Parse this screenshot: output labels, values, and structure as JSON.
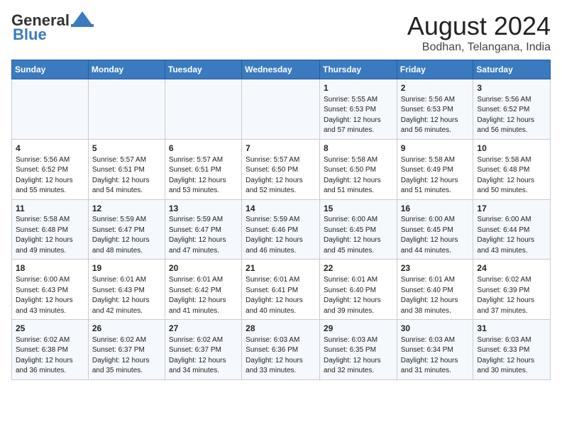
{
  "logo": {
    "line1": "General",
    "line2": "Blue"
  },
  "title": "August 2024",
  "subtitle": "Bodhan, Telangana, India",
  "weekdays": [
    "Sunday",
    "Monday",
    "Tuesday",
    "Wednesday",
    "Thursday",
    "Friday",
    "Saturday"
  ],
  "weeks": [
    [
      {
        "day": "",
        "info": ""
      },
      {
        "day": "",
        "info": ""
      },
      {
        "day": "",
        "info": ""
      },
      {
        "day": "",
        "info": ""
      },
      {
        "day": "1",
        "info": "Sunrise: 5:55 AM\nSunset: 6:53 PM\nDaylight: 12 hours\nand 57 minutes."
      },
      {
        "day": "2",
        "info": "Sunrise: 5:56 AM\nSunset: 6:53 PM\nDaylight: 12 hours\nand 56 minutes."
      },
      {
        "day": "3",
        "info": "Sunrise: 5:56 AM\nSunset: 6:52 PM\nDaylight: 12 hours\nand 56 minutes."
      }
    ],
    [
      {
        "day": "4",
        "info": "Sunrise: 5:56 AM\nSunset: 6:52 PM\nDaylight: 12 hours\nand 55 minutes."
      },
      {
        "day": "5",
        "info": "Sunrise: 5:57 AM\nSunset: 6:51 PM\nDaylight: 12 hours\nand 54 minutes."
      },
      {
        "day": "6",
        "info": "Sunrise: 5:57 AM\nSunset: 6:51 PM\nDaylight: 12 hours\nand 53 minutes."
      },
      {
        "day": "7",
        "info": "Sunrise: 5:57 AM\nSunset: 6:50 PM\nDaylight: 12 hours\nand 52 minutes."
      },
      {
        "day": "8",
        "info": "Sunrise: 5:58 AM\nSunset: 6:50 PM\nDaylight: 12 hours\nand 51 minutes."
      },
      {
        "day": "9",
        "info": "Sunrise: 5:58 AM\nSunset: 6:49 PM\nDaylight: 12 hours\nand 51 minutes."
      },
      {
        "day": "10",
        "info": "Sunrise: 5:58 AM\nSunset: 6:48 PM\nDaylight: 12 hours\nand 50 minutes."
      }
    ],
    [
      {
        "day": "11",
        "info": "Sunrise: 5:58 AM\nSunset: 6:48 PM\nDaylight: 12 hours\nand 49 minutes."
      },
      {
        "day": "12",
        "info": "Sunrise: 5:59 AM\nSunset: 6:47 PM\nDaylight: 12 hours\nand 48 minutes."
      },
      {
        "day": "13",
        "info": "Sunrise: 5:59 AM\nSunset: 6:47 PM\nDaylight: 12 hours\nand 47 minutes."
      },
      {
        "day": "14",
        "info": "Sunrise: 5:59 AM\nSunset: 6:46 PM\nDaylight: 12 hours\nand 46 minutes."
      },
      {
        "day": "15",
        "info": "Sunrise: 6:00 AM\nSunset: 6:45 PM\nDaylight: 12 hours\nand 45 minutes."
      },
      {
        "day": "16",
        "info": "Sunrise: 6:00 AM\nSunset: 6:45 PM\nDaylight: 12 hours\nand 44 minutes."
      },
      {
        "day": "17",
        "info": "Sunrise: 6:00 AM\nSunset: 6:44 PM\nDaylight: 12 hours\nand 43 minutes."
      }
    ],
    [
      {
        "day": "18",
        "info": "Sunrise: 6:00 AM\nSunset: 6:43 PM\nDaylight: 12 hours\nand 43 minutes."
      },
      {
        "day": "19",
        "info": "Sunrise: 6:01 AM\nSunset: 6:43 PM\nDaylight: 12 hours\nand 42 minutes."
      },
      {
        "day": "20",
        "info": "Sunrise: 6:01 AM\nSunset: 6:42 PM\nDaylight: 12 hours\nand 41 minutes."
      },
      {
        "day": "21",
        "info": "Sunrise: 6:01 AM\nSunset: 6:41 PM\nDaylight: 12 hours\nand 40 minutes."
      },
      {
        "day": "22",
        "info": "Sunrise: 6:01 AM\nSunset: 6:40 PM\nDaylight: 12 hours\nand 39 minutes."
      },
      {
        "day": "23",
        "info": "Sunrise: 6:01 AM\nSunset: 6:40 PM\nDaylight: 12 hours\nand 38 minutes."
      },
      {
        "day": "24",
        "info": "Sunrise: 6:02 AM\nSunset: 6:39 PM\nDaylight: 12 hours\nand 37 minutes."
      }
    ],
    [
      {
        "day": "25",
        "info": "Sunrise: 6:02 AM\nSunset: 6:38 PM\nDaylight: 12 hours\nand 36 minutes."
      },
      {
        "day": "26",
        "info": "Sunrise: 6:02 AM\nSunset: 6:37 PM\nDaylight: 12 hours\nand 35 minutes."
      },
      {
        "day": "27",
        "info": "Sunrise: 6:02 AM\nSunset: 6:37 PM\nDaylight: 12 hours\nand 34 minutes."
      },
      {
        "day": "28",
        "info": "Sunrise: 6:03 AM\nSunset: 6:36 PM\nDaylight: 12 hours\nand 33 minutes."
      },
      {
        "day": "29",
        "info": "Sunrise: 6:03 AM\nSunset: 6:35 PM\nDaylight: 12 hours\nand 32 minutes."
      },
      {
        "day": "30",
        "info": "Sunrise: 6:03 AM\nSunset: 6:34 PM\nDaylight: 12 hours\nand 31 minutes."
      },
      {
        "day": "31",
        "info": "Sunrise: 6:03 AM\nSunset: 6:33 PM\nDaylight: 12 hours\nand 30 minutes."
      }
    ]
  ]
}
